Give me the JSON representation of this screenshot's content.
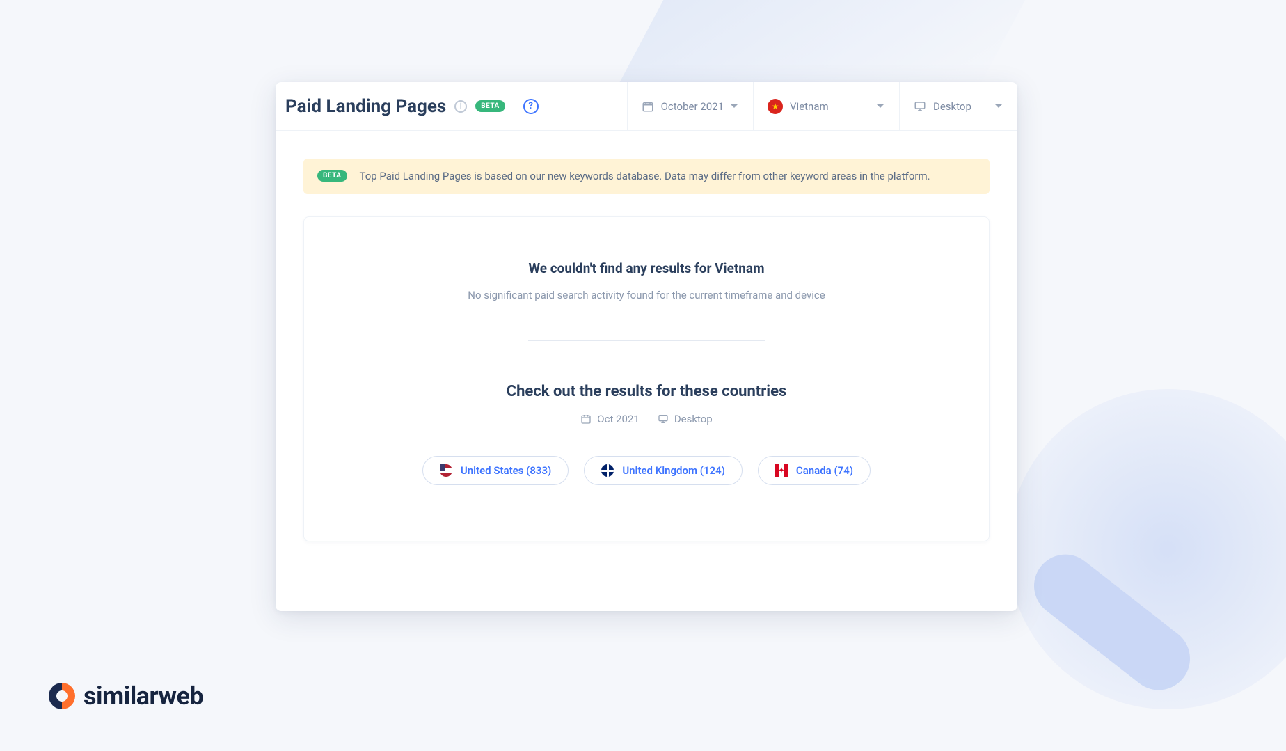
{
  "brand": {
    "name": "similarweb"
  },
  "header": {
    "title": "Paid Landing Pages",
    "beta_label": "BETA",
    "date": {
      "label": "October 2021"
    },
    "country": {
      "label": "Vietnam",
      "flag": "vn"
    },
    "device": {
      "label": "Desktop"
    }
  },
  "alert": {
    "badge": "BETA",
    "text": "Top Paid Landing Pages is based on our new keywords database. Data may differ from other keyword areas in the platform."
  },
  "empty": {
    "title": "We couldn't find any results for Vietnam",
    "subtitle": "No significant paid search activity found for the current timeframe and device"
  },
  "suggest": {
    "title": "Check out the results for these countries",
    "date": "Oct 2021",
    "device": "Desktop",
    "countries": [
      {
        "label": "United States (833)",
        "flag": "us"
      },
      {
        "label": "United Kingdom (124)",
        "flag": "uk"
      },
      {
        "label": "Canada (74)",
        "flag": "ca"
      }
    ]
  }
}
